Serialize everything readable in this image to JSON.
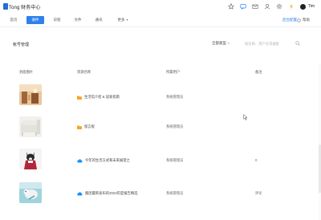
{
  "header": {
    "brand": "Tong 财务中心",
    "icons": [
      "star-icon",
      "chat-icon",
      "mail-icon",
      "user-switch-icon",
      "settings-icon",
      "lightning-icon"
    ],
    "user_name": "Tim"
  },
  "tabs": [
    {
      "label": "首页",
      "active": false
    },
    {
      "label": "收件",
      "active": true
    },
    {
      "label": "日程",
      "active": false
    },
    {
      "label": "文件",
      "active": false
    },
    {
      "label": "通讯",
      "active": false
    },
    {
      "label": "更多",
      "active": false
    }
  ],
  "tab_right": {
    "link_label": "后台配置",
    "help_label": "帮助"
  },
  "toolbar": {
    "title": "帐号管理",
    "filter_label": "全部类型",
    "search_placeholder": "按名称、用户名等搜索"
  },
  "table": {
    "columns": [
      "封面图片",
      "资源名称",
      "所属用户",
      "备注"
    ],
    "rows": [
      {
        "thumb": "wooden-interior-photo",
        "icon": "folder-icon",
        "name": "生活馆介绍 & 居家指南",
        "owner": "系统管理员",
        "extra": ""
      },
      {
        "thumb": "white-sofa-photo",
        "icon": "folder-icon",
        "name": "留言板",
        "owner": "系统管理员",
        "extra": ""
      },
      {
        "thumb": "dog-photo",
        "icon": "cloud-icon",
        "name": "今年的生活方式和未来展望之",
        "owner": "系统管理员",
        "extra": "0"
      },
      {
        "thumb": "dog-on-beach-photo",
        "icon": "cloud-icon",
        "name": "集团最新发布的2023年度报告精选",
        "owner": "系统管理员",
        "extra": "评论"
      }
    ]
  },
  "colors": {
    "accent": "#2f80ed",
    "folder": "#f5a623",
    "cloud": "#1890ff"
  }
}
